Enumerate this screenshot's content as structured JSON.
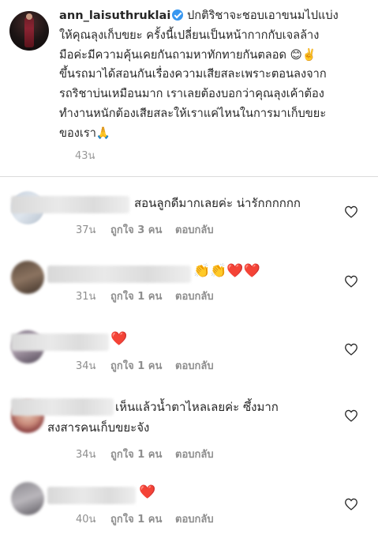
{
  "post": {
    "username": "ann_laisuthruklai",
    "lines": [
      "ปกติริชาจะชอบเอาขนมไปแบ่ง",
      "ให้คุณลุงเก็บขยะ ครั้งนี้เปลี่ยนเป็นหน้ากากกับเจลล้าง",
      "มือค่ะมีความคุ้นเคยกันถามหาทักทายกันตลอด 😊✌️",
      "ขึ้นรถมาได้สอนกันเรื่องความเสียสละเพราะตอนลงจาก",
      "รถริชาบ่นเหมือนมาก เราเลยต้องบอกว่าคุณลุงเค้าต้อง",
      "ทำงานหนักต้องเสียสละให้เราแค่ไหนในการมาเก็บขยะ",
      "ของเรา🙏"
    ],
    "time": "43น"
  },
  "comments": [
    {
      "lines": [
        "สอนลูกดีมากเลยค่ะ น่ารักกกกกก"
      ],
      "time": "37น",
      "likes": "ถูกใจ 3 คน",
      "reply": "ตอบกลับ"
    },
    {
      "lines": [
        "👏👏❤️❤️"
      ],
      "time": "31น",
      "likes": "ถูกใจ 1 คน",
      "reply": "ตอบกลับ"
    },
    {
      "lines": [
        "❤️"
      ],
      "time": "34น",
      "likes": "ถูกใจ 1 คน",
      "reply": "ตอบกลับ"
    },
    {
      "lines": [
        "เห็นแล้วน้ำตาไหลเลยค่ะ ซึ้งมาก",
        "สงสารคนเก็บขยะจัง"
      ],
      "time": "34น",
      "likes": "ถูกใจ 1 คน",
      "reply": "ตอบกลับ"
    },
    {
      "lines": [
        "❤️"
      ],
      "time": "40น",
      "likes": "ถูกใจ 1 คน",
      "reply": "ตอบกลับ"
    }
  ],
  "icons": {
    "verified": "verified-badge-icon",
    "like": "heart-outline-icon"
  },
  "colors": {
    "verified": "#3897f0",
    "meta": "#8e8e8e",
    "text": "#262626",
    "heart": "#ed4956"
  }
}
